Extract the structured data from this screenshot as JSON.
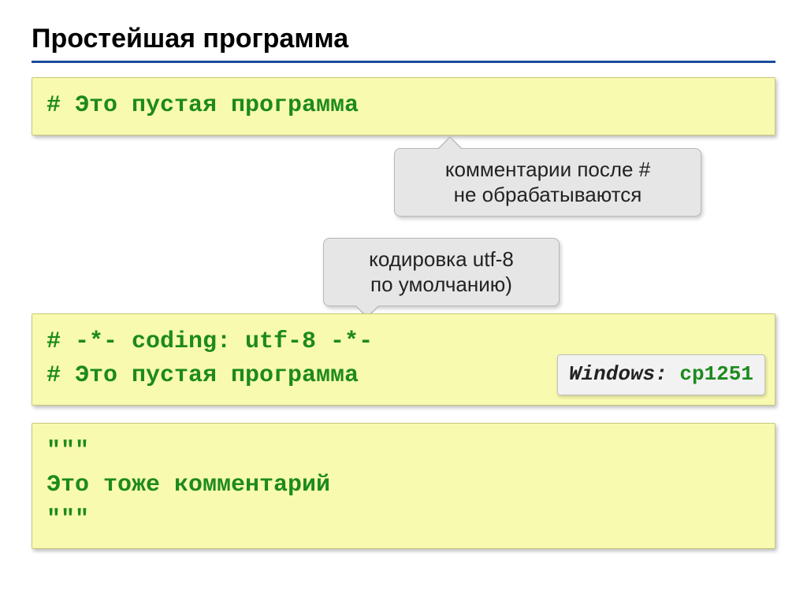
{
  "title": "Простейшая программа",
  "box1": {
    "line1": "# Это пустая программа"
  },
  "callout1": {
    "line1": "комментарии после #",
    "line2": "не обрабатываются"
  },
  "callout2": {
    "line1": "кодировка utf-8",
    "line2": "по умолчанию)"
  },
  "box2": {
    "line1": "# -*- coding: utf-8 -*-",
    "line2": "# Это пустая программа"
  },
  "label": {
    "prefix": "Windows: ",
    "code": "cp1251"
  },
  "box3": {
    "line1": "\"\"\"",
    "line2": "Это тоже комментарий",
    "line3": "\"\"\""
  }
}
